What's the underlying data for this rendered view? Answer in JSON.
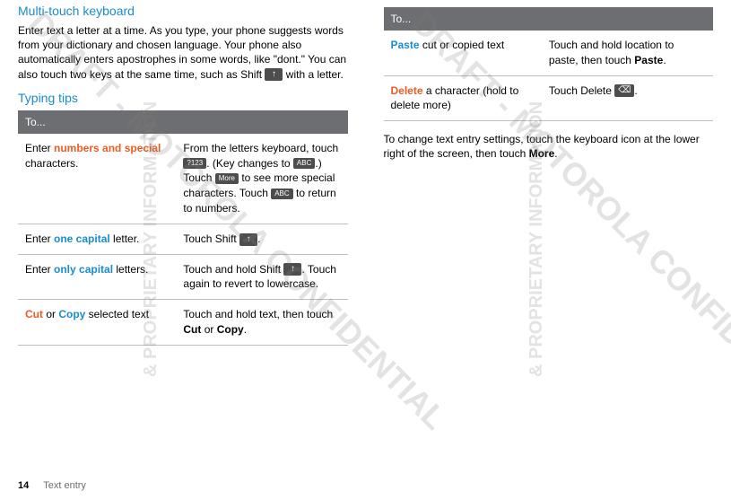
{
  "left": {
    "heading1": "Multi-touch keyboard",
    "para1_a": "Enter text a letter at a time. As you type, your phone suggests words from your dictionary and chosen language. Your phone also automatically enters apostrophes in some words, like \"dont.\" You can also touch two keys at the same time, such as Shift ",
    "para1_b": " with a letter.",
    "heading2": "Typing tips",
    "table_header": "To...",
    "rows": {
      "r1": {
        "a_pre": "Enter ",
        "a_kw1": "numbers and special",
        "a_post": " characters.",
        "b_1": "From the letters keyboard, touch ",
        "b_key1": "?123",
        "b_2": ". (Key changes to ",
        "b_key2": "ABC",
        "b_3": ".) Touch ",
        "b_key3": "More",
        "b_4": " to see more special characters. Touch ",
        "b_key4": "ABC",
        "b_5": " to return to numbers."
      },
      "r2": {
        "a_pre": "Enter ",
        "a_kw": "one capital",
        "a_post": " letter.",
        "b_1": "Touch Shift ",
        "b_2": "."
      },
      "r3": {
        "a_pre": "Enter ",
        "a_kw": "only capital",
        "a_post": " letters.",
        "b_1": "Touch and hold Shift ",
        "b_2": ". Touch again to revert to lowercase."
      },
      "r4": {
        "a_kw1": "Cut",
        "a_mid": " or ",
        "a_kw2": "Copy",
        "a_post": " selected text",
        "b_1": "Touch and hold text, then touch ",
        "b_bold1": "Cut",
        "b_mid": " or ",
        "b_bold2": "Copy",
        "b_end": "."
      }
    }
  },
  "right": {
    "table_header": "To...",
    "rows": {
      "r1": {
        "a_kw": "Paste",
        "a_post": " cut or copied text",
        "b_1": "Touch and hold location to paste, then touch ",
        "b_bold": "Paste",
        "b_end": "."
      },
      "r2": {
        "a_kw": "Delete",
        "a_post": " a character (hold to delete more)",
        "b_1": "Touch Delete ",
        "b_2": "."
      }
    },
    "para_a": "To change text entry settings, touch the keyboard icon at the lower right of the screen, then touch ",
    "para_bold": "More",
    "para_b": "."
  },
  "watermarks": {
    "draft": "DRAFT - MOTOROLA CONFIDENTIAL",
    "prop": "& PROPRIETARY INFORMATION"
  },
  "footer": {
    "page": "14",
    "section": "Text entry"
  }
}
